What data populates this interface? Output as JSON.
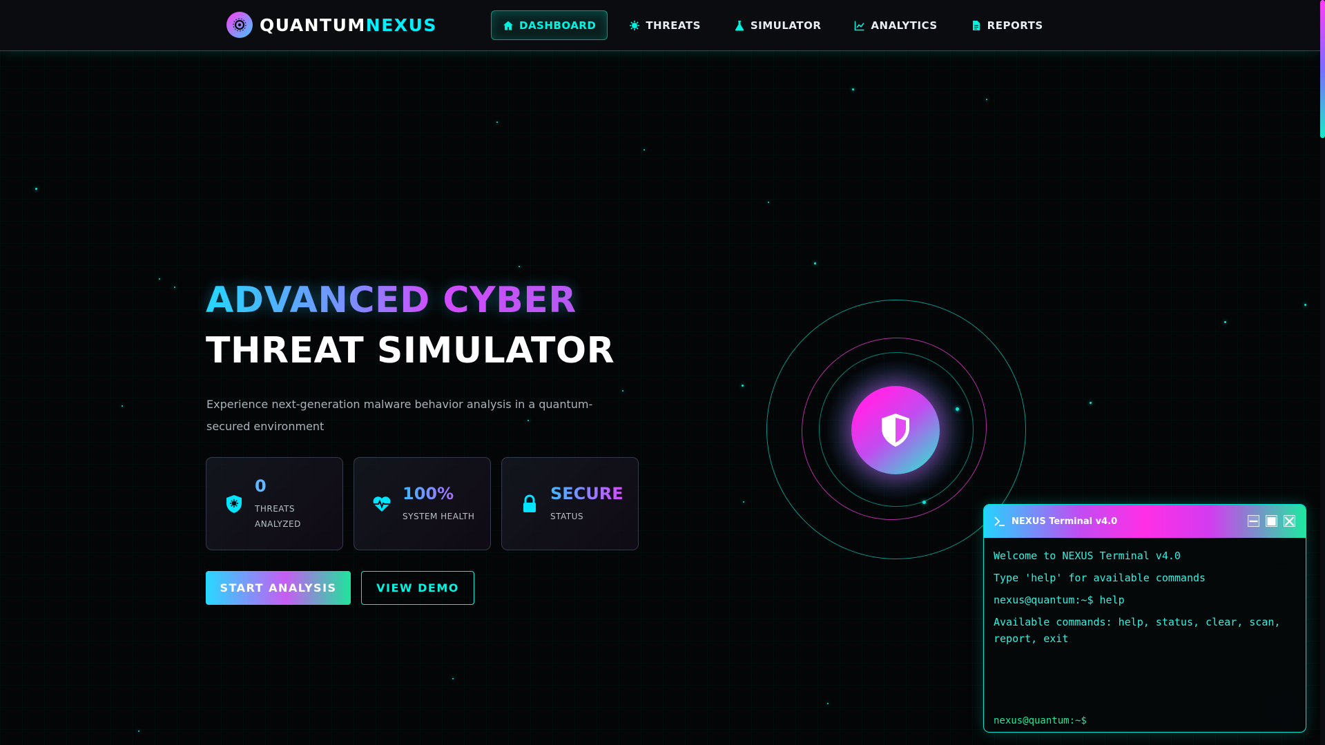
{
  "brand": {
    "name_a": "QUANTUM",
    "name_b": "NEXUS"
  },
  "nav": {
    "items": [
      {
        "label": "DASHBOARD",
        "icon": "home-icon",
        "active": true
      },
      {
        "label": "THREATS",
        "icon": "virus-icon",
        "active": false
      },
      {
        "label": "SIMULATOR",
        "icon": "flask-icon",
        "active": false
      },
      {
        "label": "ANALYTICS",
        "icon": "chart-line-icon",
        "active": false
      },
      {
        "label": "REPORTS",
        "icon": "file-icon",
        "active": false
      }
    ]
  },
  "hero": {
    "title_line1": "ADVANCED CYBER",
    "title_line2": "THREAT SIMULATOR",
    "subtitle": "Experience next-generation malware behavior analysis in a quantum-secured environment"
  },
  "stats": [
    {
      "value": "0",
      "label_line1": "THREATS",
      "label_line2": "ANALYZED",
      "icon": "shield-virus-icon"
    },
    {
      "value": "100%",
      "label_line1": "SYSTEM HEALTH",
      "label_line2": "",
      "icon": "heartbeat-icon"
    },
    {
      "value": "SECURE",
      "label_line1": "STATUS",
      "label_line2": "",
      "icon": "lock-icon"
    }
  ],
  "buttons": {
    "primary": "START ANALYSIS",
    "secondary": "VIEW DEMO"
  },
  "terminal": {
    "title": "NEXUS Terminal v4.0",
    "lines": [
      "Welcome to NEXUS Terminal v4.0",
      "Type 'help' for available commands",
      "nexus@quantum:~$ help",
      "Available commands: help, status, clear, scan, report, exit"
    ],
    "prompt": "nexus@quantum:~$"
  },
  "colors": {
    "accent_cyan": "#00f0e0",
    "accent_magenta": "#ff2fe6",
    "accent_blue": "#27d8ff",
    "accent_green": "#1ee9a1",
    "background": "#040506"
  }
}
